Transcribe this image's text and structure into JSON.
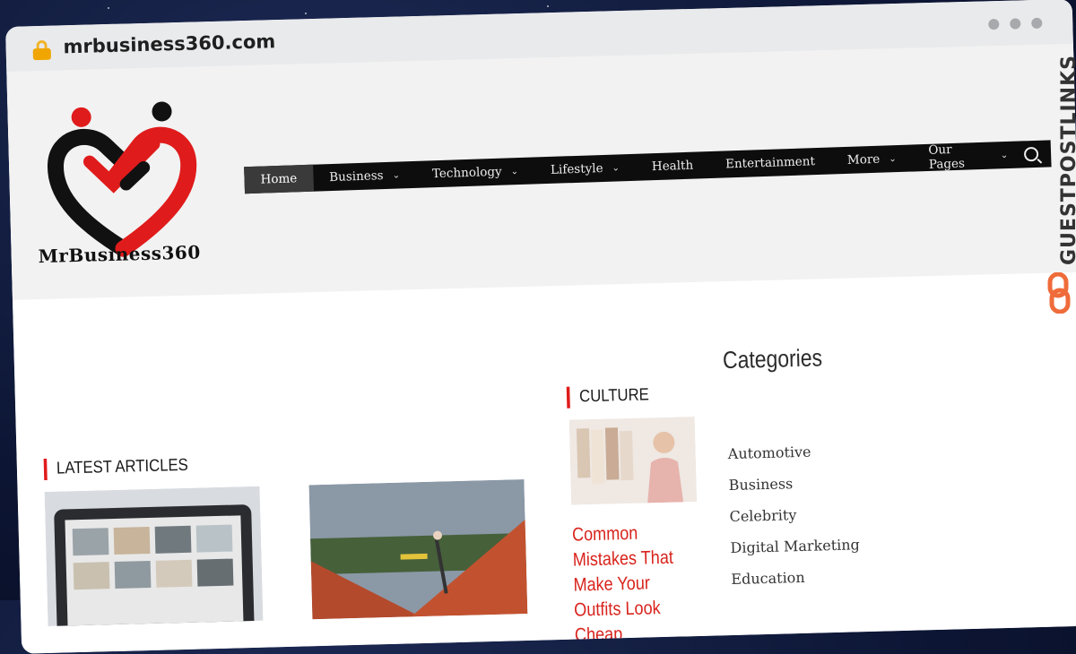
{
  "browser": {
    "url": "mrbusiness360.com"
  },
  "site": {
    "logo_text": "MrBusiness360",
    "nav": [
      {
        "label": "Home",
        "dropdown": false,
        "active": true
      },
      {
        "label": "Business",
        "dropdown": true
      },
      {
        "label": "Technology",
        "dropdown": true
      },
      {
        "label": "Lifestyle",
        "dropdown": true
      },
      {
        "label": "Health",
        "dropdown": false
      },
      {
        "label": "Entertainment",
        "dropdown": false
      },
      {
        "label": "More",
        "dropdown": true
      },
      {
        "label": "Our Pages",
        "dropdown": true
      }
    ],
    "latest_title": "LATEST ARTICLES",
    "culture_title": "CULTURE",
    "culture_article_title": "Common Mistakes That Make Your Outfits Look Cheap",
    "categories_title": "Categories",
    "categories": [
      "Automotive",
      "Business",
      "Celebrity",
      "Digital Marketing",
      "Education"
    ]
  },
  "watermark": {
    "text": "GUESTPOSTLINKS"
  },
  "colors": {
    "accent": "#e01b1b",
    "nav_bg": "#0d0d0d",
    "header_bg": "#f2f2f2"
  },
  "icons": {
    "lock": "lock-icon",
    "search": "search-icon",
    "chevron": "chevron-down-icon"
  }
}
